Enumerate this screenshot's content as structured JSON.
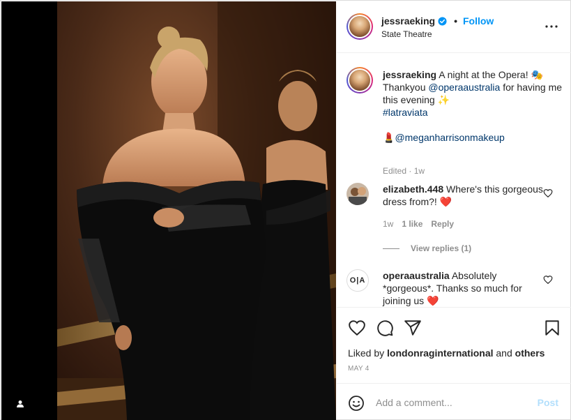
{
  "header": {
    "username": "jessraeking",
    "separator": "•",
    "follow_label": "Follow",
    "location": "State Theatre",
    "more_icon": "more-horizontal-icon"
  },
  "caption": {
    "username": "jessraeking",
    "text_1": "A night at the Opera! 🎭",
    "text_2": "Thankyou",
    "mention_1": "@operaaustralia",
    "text_3": "for having me this evening ✨",
    "hashtag": "#latraviata",
    "lipstick": "💄",
    "mention_2": "@meganharrisonmakeup",
    "meta": "Edited · 1w"
  },
  "comments": [
    {
      "username": "elizabeth.448",
      "text": "Where's this gorgeous dress from?! ❤️",
      "time": "1w",
      "likes": "1 like",
      "reply": "Reply",
      "view_replies": "View replies (1)"
    },
    {
      "username": "operaaustralia",
      "text": "Absolutely *gorgeous*. Thanks so much for joining us ❤️",
      "avatar_text": "O|A"
    }
  ],
  "actions": {
    "liked_by_prefix": "Liked by",
    "liked_by_user": "londonraginternational",
    "liked_by_and": "and",
    "liked_by_others": "others",
    "date": "MAY 4"
  },
  "add_comment": {
    "placeholder": "Add a comment...",
    "post_label": "Post"
  },
  "colors": {
    "accent": "#0095f6",
    "link": "#00376b",
    "muted": "#8e8e8e",
    "like_red": "#ed4956"
  }
}
